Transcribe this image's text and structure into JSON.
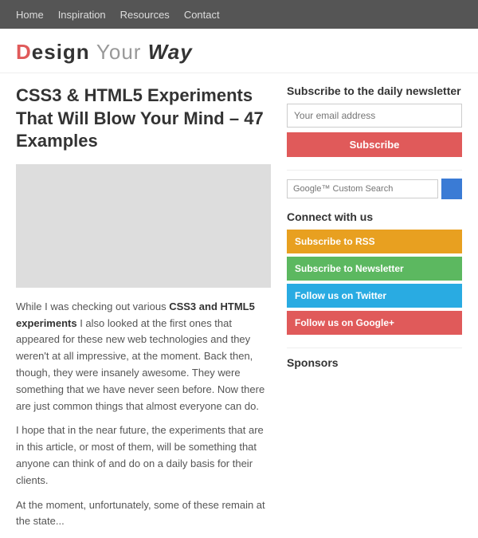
{
  "nav": {
    "items": [
      "Home",
      "Inspiration",
      "Resources",
      "Contact"
    ]
  },
  "logo": {
    "d": "D",
    "esign": "esign",
    "your": "Your",
    "way": "Way"
  },
  "article": {
    "title": "CSS3 & HTML5 Experiments That Will Blow Your Mind – 47 Examples",
    "body_p1": "While I was checking out various CSS3 and HTML5 experiments I also looked at the first ones that appeared for these new web technologies and they weren't at all impressive, at the moment. Back then, though, they were insanely awesome. They were something that we have never seen before. Now there are just common things that almost everyone can do.",
    "body_p2": "I hope that in the near future, the experiments that are in this article, or most of them, will be something that anyone can think of and do on a daily basis for their clients.",
    "body_p3": "At the moment, unfortunately, some of these remain at the state..."
  },
  "sidebar": {
    "newsletter": {
      "title": "Subscribe to the daily newsletter",
      "email_placeholder": "Your email address",
      "subscribe_label": "Subscribe"
    },
    "search": {
      "placeholder": "Google™ Custom Search"
    },
    "connect": {
      "title": "Connect with us",
      "buttons": [
        {
          "label": "Subscribe to RSS",
          "color": "orange"
        },
        {
          "label": "Subscribe to Newsletter",
          "color": "green"
        },
        {
          "label": "Follow us on Twitter",
          "color": "blue"
        },
        {
          "label": "Follow us on Google+",
          "color": "red"
        }
      ]
    },
    "sponsors": {
      "title": "Sponsors"
    }
  }
}
